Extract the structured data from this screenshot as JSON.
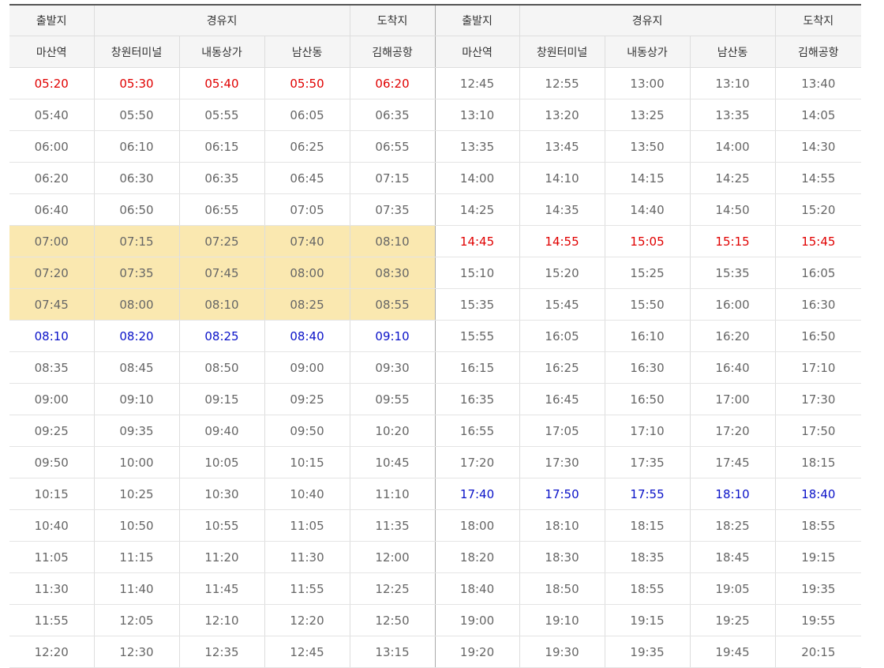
{
  "header": {
    "departure": "출발지",
    "via": "경유지",
    "arrival": "도착지",
    "stops": [
      "마산역",
      "창원터미널",
      "내동상가",
      "남산동",
      "김해공항"
    ]
  },
  "colors": {
    "first_bus": "#e00000",
    "last_bus": "#0a12c8",
    "peak_highlight": "#fae8b0"
  },
  "left_rows": [
    {
      "times": [
        "05:20",
        "05:30",
        "05:40",
        "05:50",
        "06:20"
      ],
      "style": "red"
    },
    {
      "times": [
        "05:40",
        "05:50",
        "05:55",
        "06:05",
        "06:35"
      ],
      "style": ""
    },
    {
      "times": [
        "06:00",
        "06:10",
        "06:15",
        "06:25",
        "06:55"
      ],
      "style": ""
    },
    {
      "times": [
        "06:20",
        "06:30",
        "06:35",
        "06:45",
        "07:15"
      ],
      "style": ""
    },
    {
      "times": [
        "06:40",
        "06:50",
        "06:55",
        "07:05",
        "07:35"
      ],
      "style": ""
    },
    {
      "times": [
        "07:00",
        "07:15",
        "07:25",
        "07:40",
        "08:10"
      ],
      "style": "hl"
    },
    {
      "times": [
        "07:20",
        "07:35",
        "07:45",
        "08:00",
        "08:30"
      ],
      "style": "hl"
    },
    {
      "times": [
        "07:45",
        "08:00",
        "08:10",
        "08:25",
        "08:55"
      ],
      "style": "hl"
    },
    {
      "times": [
        "08:10",
        "08:20",
        "08:25",
        "08:40",
        "09:10"
      ],
      "style": "blue"
    },
    {
      "times": [
        "08:35",
        "08:45",
        "08:50",
        "09:00",
        "09:30"
      ],
      "style": ""
    },
    {
      "times": [
        "09:00",
        "09:10",
        "09:15",
        "09:25",
        "09:55"
      ],
      "style": ""
    },
    {
      "times": [
        "09:25",
        "09:35",
        "09:40",
        "09:50",
        "10:20"
      ],
      "style": ""
    },
    {
      "times": [
        "09:50",
        "10:00",
        "10:05",
        "10:15",
        "10:45"
      ],
      "style": ""
    },
    {
      "times": [
        "10:15",
        "10:25",
        "10:30",
        "10:40",
        "11:10"
      ],
      "style": ""
    },
    {
      "times": [
        "10:40",
        "10:50",
        "10:55",
        "11:05",
        "11:35"
      ],
      "style": ""
    },
    {
      "times": [
        "11:05",
        "11:15",
        "11:20",
        "11:30",
        "12:00"
      ],
      "style": ""
    },
    {
      "times": [
        "11:30",
        "11:40",
        "11:45",
        "11:55",
        "12:25"
      ],
      "style": ""
    },
    {
      "times": [
        "11:55",
        "12:05",
        "12:10",
        "12:20",
        "12:50"
      ],
      "style": ""
    },
    {
      "times": [
        "12:20",
        "12:30",
        "12:35",
        "12:45",
        "13:15"
      ],
      "style": ""
    }
  ],
  "right_rows": [
    {
      "times": [
        "12:45",
        "12:55",
        "13:00",
        "13:10",
        "13:40"
      ],
      "style": ""
    },
    {
      "times": [
        "13:10",
        "13:20",
        "13:25",
        "13:35",
        "14:05"
      ],
      "style": ""
    },
    {
      "times": [
        "13:35",
        "13:45",
        "13:50",
        "14:00",
        "14:30"
      ],
      "style": ""
    },
    {
      "times": [
        "14:00",
        "14:10",
        "14:15",
        "14:25",
        "14:55"
      ],
      "style": ""
    },
    {
      "times": [
        "14:25",
        "14:35",
        "14:40",
        "14:50",
        "15:20"
      ],
      "style": ""
    },
    {
      "times": [
        "14:45",
        "14:55",
        "15:05",
        "15:15",
        "15:45"
      ],
      "style": "red"
    },
    {
      "times": [
        "15:10",
        "15:20",
        "15:25",
        "15:35",
        "16:05"
      ],
      "style": ""
    },
    {
      "times": [
        "15:35",
        "15:45",
        "15:50",
        "16:00",
        "16:30"
      ],
      "style": ""
    },
    {
      "times": [
        "15:55",
        "16:05",
        "16:10",
        "16:20",
        "16:50"
      ],
      "style": ""
    },
    {
      "times": [
        "16:15",
        "16:25",
        "16:30",
        "16:40",
        "17:10"
      ],
      "style": ""
    },
    {
      "times": [
        "16:35",
        "16:45",
        "16:50",
        "17:00",
        "17:30"
      ],
      "style": ""
    },
    {
      "times": [
        "16:55",
        "17:05",
        "17:10",
        "17:20",
        "17:50"
      ],
      "style": ""
    },
    {
      "times": [
        "17:20",
        "17:30",
        "17:35",
        "17:45",
        "18:15"
      ],
      "style": ""
    },
    {
      "times": [
        "17:40",
        "17:50",
        "17:55",
        "18:10",
        "18:40"
      ],
      "style": "blue"
    },
    {
      "times": [
        "18:00",
        "18:10",
        "18:15",
        "18:25",
        "18:55"
      ],
      "style": ""
    },
    {
      "times": [
        "18:20",
        "18:30",
        "18:35",
        "18:45",
        "19:15"
      ],
      "style": ""
    },
    {
      "times": [
        "18:40",
        "18:50",
        "18:55",
        "19:05",
        "19:35"
      ],
      "style": ""
    },
    {
      "times": [
        "19:00",
        "19:10",
        "19:15",
        "19:25",
        "19:55"
      ],
      "style": ""
    },
    {
      "times": [
        "19:20",
        "19:30",
        "19:35",
        "19:45",
        "20:15"
      ],
      "style": ""
    }
  ]
}
